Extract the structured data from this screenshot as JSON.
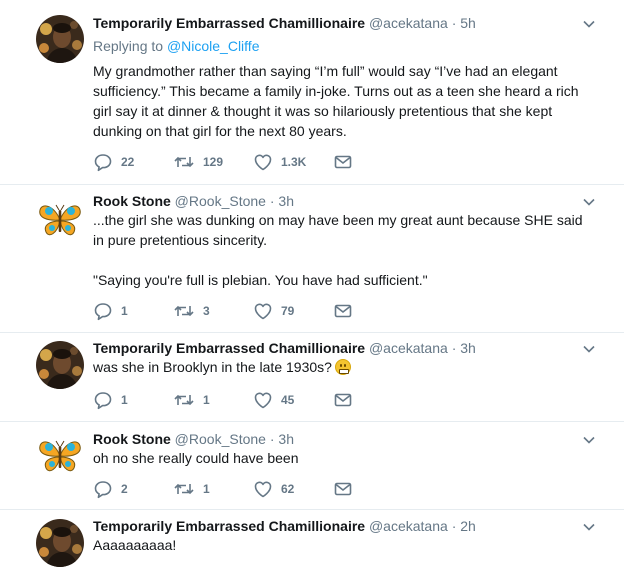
{
  "tweets": [
    {
      "name": "Temporarily Embarrassed Chamillionaire",
      "handle": "@acekatana",
      "dot": "·",
      "time": "5h",
      "replying_prefix": "Replying to",
      "replying_to": "@Nicole_Cliffe",
      "text": "My grandmother rather than saying “I’m full” would say “I’ve had an elegant sufficiency.” This became a family in-joke. Turns out as a teen she heard a rich girl say it at dinner & thought it was so hilariously pretentious that she kept dunking on that girl for the next 80 years.",
      "replies": "22",
      "retweets": "129",
      "likes": "1.3K",
      "avatar": "portrait-avatar"
    },
    {
      "name": "Rook Stone",
      "handle": "@Rook_Stone",
      "dot": "·",
      "time": "3h",
      "text1": "...the girl she was dunking on may have been my great aunt because SHE said in pure pretentious sincerity.",
      "text2": "\"Saying you're full is plebian. You have had sufficient.\"",
      "replies": "1",
      "retweets": "3",
      "likes": "79",
      "avatar": "butterfly-avatar"
    },
    {
      "name": "Temporarily Embarrassed Chamillionaire",
      "handle": "@acekatana",
      "dot": "·",
      "time": "3h",
      "text": "was she in Brooklyn in the late 1930s?",
      "emoji": "grimacing-face",
      "replies": "1",
      "retweets": "1",
      "likes": "45",
      "avatar": "portrait-avatar"
    },
    {
      "name": "Rook Stone",
      "handle": "@Rook_Stone",
      "dot": "·",
      "time": "3h",
      "text": "oh no she really could have been",
      "replies": "2",
      "retweets": "1",
      "likes": "62",
      "avatar": "butterfly-avatar"
    },
    {
      "name": "Temporarily Embarrassed Chamillionaire",
      "handle": "@acekatana",
      "dot": "·",
      "time": "2h",
      "text": "Aaaaaaaaaa!",
      "avatar": "portrait-avatar"
    }
  ],
  "colors": {
    "text": "#14171a",
    "muted": "#657786",
    "link": "#1da1f2",
    "border": "#e6ecf0"
  }
}
